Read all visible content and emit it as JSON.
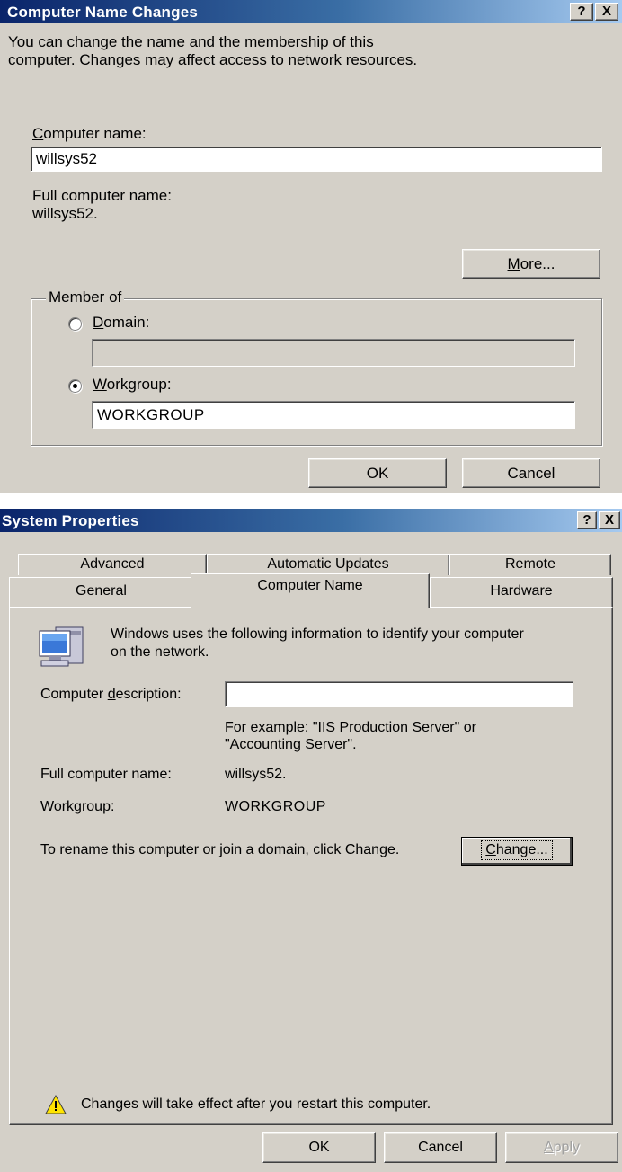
{
  "dialog1": {
    "title": "Computer Name Changes",
    "help_label": "?",
    "close_label": "X",
    "intro_line1": "You can change the name and the membership of this",
    "intro_line2": "computer. Changes may affect access to network resources.",
    "computer_name_label_accel": "C",
    "computer_name_label_rest": "omputer name:",
    "computer_name_value": "willsys52",
    "full_name_label": "Full computer name:",
    "full_name_value": "willsys52.",
    "more_label_accel": "M",
    "more_label_rest": "ore...",
    "member_of_label": "Member of",
    "domain_label_accel": "D",
    "domain_label_rest": "omain:",
    "domain_value": "",
    "workgroup_label_accel": "W",
    "workgroup_label_rest": "orkgroup:",
    "workgroup_value": "WORKGROUP",
    "ok_label": "OK",
    "cancel_label": "Cancel"
  },
  "dialog2": {
    "title": "System Properties",
    "help_label": "?",
    "close_label": "X",
    "tabs_back": [
      "Advanced",
      "Automatic Updates",
      "Remote"
    ],
    "tabs_front": [
      "General",
      "Computer Name",
      "Hardware"
    ],
    "active_tab": "Computer Name",
    "info_line1": "Windows uses the following information to identify your computer",
    "info_line2": "on the network.",
    "description_label_pre": "Computer ",
    "description_label_accel": "d",
    "description_label_post": "escription:",
    "description_value": "",
    "example_line1": "For example: \"IIS Production Server\" or",
    "example_line2": "\"Accounting Server\".",
    "full_name_label": "Full computer name:",
    "full_name_value": "willsys52.",
    "workgroup_label": "Workgroup:",
    "workgroup_value": "WORKGROUP",
    "rename_text": "To rename this computer or join a domain, click Change.",
    "change_label_accel": "C",
    "change_label_rest": "hange...",
    "warning_text": "Changes will take effect after you restart this computer.",
    "ok_label": "OK",
    "cancel_label": "Cancel",
    "apply_label_accel": "A",
    "apply_label_rest": "pply"
  }
}
